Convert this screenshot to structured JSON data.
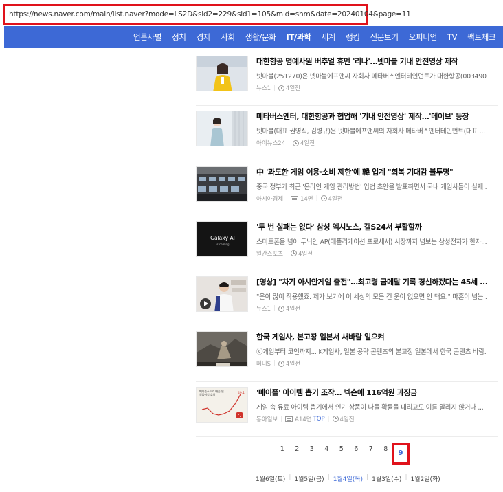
{
  "browser": {
    "url": "https://news.naver.com/main/list.naver?mode=LS2D&sid2=229&sid1=105&mid=shm&date=20240104&page=11"
  },
  "nav": {
    "items": [
      {
        "label": "언론사별",
        "active": false
      },
      {
        "label": "정치",
        "active": false
      },
      {
        "label": "경제",
        "active": false
      },
      {
        "label": "사회",
        "active": false
      },
      {
        "label": "생활/문화",
        "active": false
      },
      {
        "label": "IT/과학",
        "active": true
      },
      {
        "label": "세계",
        "active": false
      },
      {
        "label": "랭킹",
        "active": false
      },
      {
        "label": "신문보기",
        "active": false
      },
      {
        "label": "오피니언",
        "active": false
      },
      {
        "label": "TV",
        "active": false
      },
      {
        "label": "팩트체크",
        "active": false
      },
      {
        "label": "알",
        "active": false
      }
    ]
  },
  "news": [
    {
      "title": "대한항공 명예사원 버추얼 휴먼 '리나'…넷마블 기내 안전영상 제작",
      "lede": "넷마블(251270)은 넷마블에프앤씨 자회사 메타버스엔터테인먼트가 대한항공(003490)과...",
      "press": "뉴스1",
      "time": "4일전",
      "paper": "",
      "thumb": "virtual-human-yellow-icon"
    },
    {
      "title": "메타버스엔터, 대한항공과 협업해 '기내 안전영상' 제작…'메이브' 등장",
      "lede": "넷마블(대표 권영식, 김병규)은 넷마블에프앤씨의 자회사 메타버스엔터테인먼트(대표 ...",
      "press": "아이뉴스24",
      "time": "4일전",
      "paper": "",
      "thumb": "cabin-crew-icon"
    },
    {
      "title": "中 '과도한 게임 이용·소비 제한'에 韓 업계 \"회복 기대감 불투명\"",
      "lede": "중국 정부가 최근 '온라인 게임 관리방법' 입법 초안을 발표하면서 국내 게임사들이 실제...",
      "press": "아시아경제",
      "time": "4일전",
      "paper": "14면",
      "thumb": "pc-room-icon"
    },
    {
      "title": "'두 번 실패는 없다' 삼성 엑시노스, 갤S24서 부활할까",
      "lede": "스마트폰을 넘어 두뇌인 AP(애플리케이션 프로세서) 시장까지 넘보는 삼성전자가 한자...",
      "press": "일간스포츠",
      "time": "4일전",
      "paper": "",
      "thumb": "galaxy-ai-banner",
      "thumb_text": "Galaxy AI",
      "thumb_sub": "is coming"
    },
    {
      "title": "[영상] \"차기 아시안게임 출전\"…최고령 금메달 기록 경신하겠다는 45세 ...",
      "lede": "\"운이 많이 작용했죠. 제가 보기에 이 세상의 모든 건 운이 없으면 안 돼요.\" 마흔이 넘는 ...",
      "press": "뉴스1",
      "time": "4일전",
      "paper": "",
      "thumb": "video-player-icon"
    },
    {
      "title": "한국 게임사, 본고장 일본서 새바람 일으켜",
      "lede": "ⓒ게임부터 코인까지... K게임사, 일본 공략 콘텐츠의 본고장 일본에서 한국 콘텐츠 바람...",
      "press": "머니S",
      "time": "4일전",
      "paper": "",
      "thumb": "game-art-icon"
    },
    {
      "title": "'메이플' 아이템 뽑기 조작… 넥슨에 116억원 과징금",
      "lede": "게임 속 유료 아이템 뽑기에서 인기 상품이 나올 확률을 내리고도 이를 알리지 않거나 ...",
      "press": "동아일보",
      "time": "4일전",
      "paper": "A14면",
      "top": "TOP",
      "thumb": "line-chart-graphic",
      "thumb_text": "메이플스토리 매출 및",
      "thumb_sub": "영업이익 추이",
      "thumb_value": "49.1"
    }
  ],
  "pagination": {
    "pages": [
      "1",
      "2",
      "3",
      "4",
      "5",
      "6",
      "7",
      "8"
    ],
    "current": "9"
  },
  "dates": [
    {
      "label": "1월6일(토)",
      "active": false
    },
    {
      "label": "1월5일(금)",
      "active": false
    },
    {
      "label": "1월4일(목)",
      "active": true
    },
    {
      "label": "1월3일(수)",
      "active": false
    },
    {
      "label": "1월2일(화)",
      "active": false
    }
  ],
  "colors": {
    "nav_bg": "#3d69d6",
    "highlight_box": "#e0121b",
    "active_link": "#3d69d6"
  }
}
